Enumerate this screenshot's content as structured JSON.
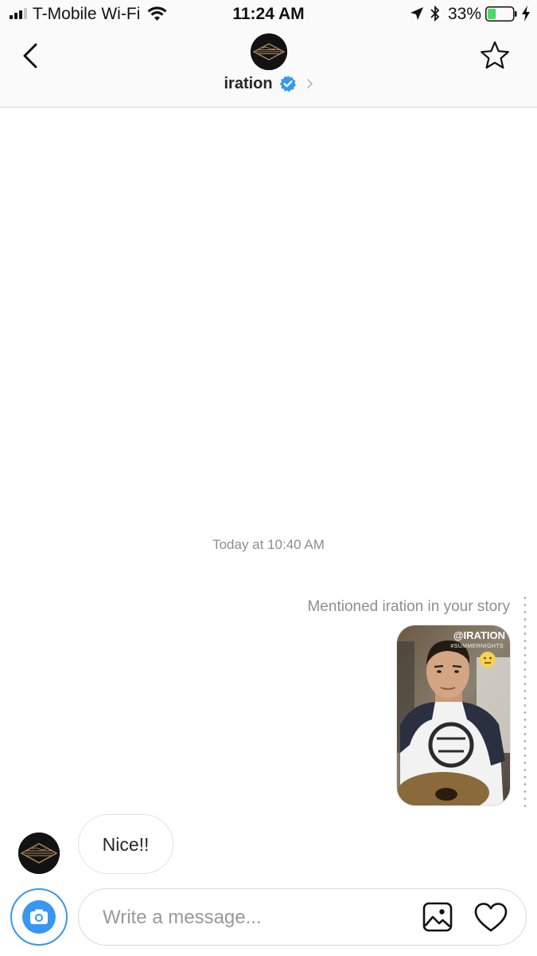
{
  "status_bar": {
    "carrier": "T-Mobile Wi-Fi",
    "time": "11:24 AM",
    "battery_percent": "33%",
    "battery_level": 0.33,
    "battery_color": "#4cd964",
    "icons": [
      "signal-icon",
      "wifi-icon",
      "location-arrow-icon",
      "bluetooth-icon",
      "battery-icon",
      "charging-bolt-icon"
    ]
  },
  "header": {
    "username": "iration",
    "verified": true,
    "icons": [
      "back-chevron-icon",
      "verified-badge-icon",
      "chevron-right-icon",
      "star-icon"
    ]
  },
  "thread": {
    "timestamp": "Today at 10:40 AM",
    "story_mention": {
      "note": "Mentioned iration in your story",
      "sticker_tag": "@IRATION",
      "sticker_hashtag": "#SUMMERNIGHTS"
    },
    "incoming_message": {
      "text": "Nice!!"
    }
  },
  "composer": {
    "placeholder": "Write a message...",
    "icons": [
      "camera-icon",
      "gallery-icon",
      "heart-icon"
    ]
  },
  "colors": {
    "accent_blue": "#3897f0",
    "verified_blue": "#3897f0",
    "muted_text": "#8e8e8e",
    "header_bg": "#fafafa"
  }
}
